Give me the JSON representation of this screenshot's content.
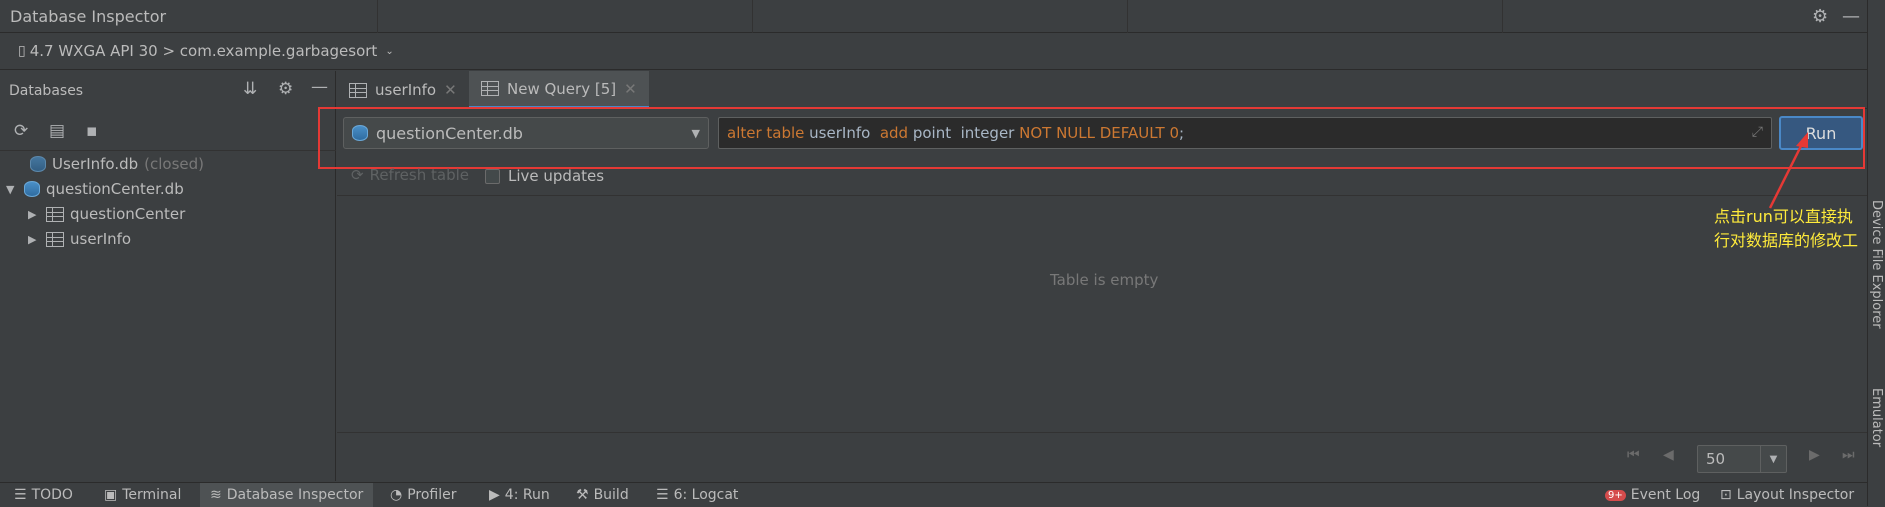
{
  "window": {
    "title": "Database Inspector"
  },
  "device": {
    "label": "4.7 WXGA API 30 > com.example.garbagesort"
  },
  "databases": {
    "header": "Databases",
    "items": [
      {
        "label": "UserInfo.db",
        "suffix": "(closed)"
      },
      {
        "label": "questionCenter.db"
      },
      {
        "label": "questionCenter"
      },
      {
        "label": "userInfo"
      }
    ]
  },
  "tabs": [
    {
      "label": "userInfo"
    },
    {
      "label": "New Query [5]"
    }
  ],
  "query": {
    "db_selected": "questionCenter.db",
    "sql_kw1": "alter table",
    "sql_id1": " userInfo ",
    "sql_kw2": " add",
    "sql_id2": " point  integer ",
    "sql_kw3": "NOT NULL DEFAULT",
    "sql_num": " 0",
    "sql_end": ";",
    "run_label": "Run"
  },
  "controls": {
    "refresh_label": "Refresh table",
    "live_updates_label": "Live updates"
  },
  "table": {
    "empty_text": "Table is empty"
  },
  "annotation": {
    "text": "点击run可以直接执\n行对数据库的修改工"
  },
  "pager": {
    "page_size": "50"
  },
  "side_tabs": {
    "device_file_explorer": "Device File Explorer",
    "emulator": "Emulator"
  },
  "statusbar": {
    "todo": "TODO",
    "terminal": "Terminal",
    "db_inspector": "Database Inspector",
    "profiler": "Profiler",
    "run": "4: Run",
    "build": "Build",
    "logcat": "6: Logcat",
    "event_log": "Event Log",
    "event_badge": "9+",
    "layout_inspector": "Layout Inspector"
  },
  "colors": {
    "accent": "#4a88c7",
    "annotation": "#ffeb3b",
    "highlight_box": "#e53935",
    "sql_keyword": "#cc7832"
  }
}
